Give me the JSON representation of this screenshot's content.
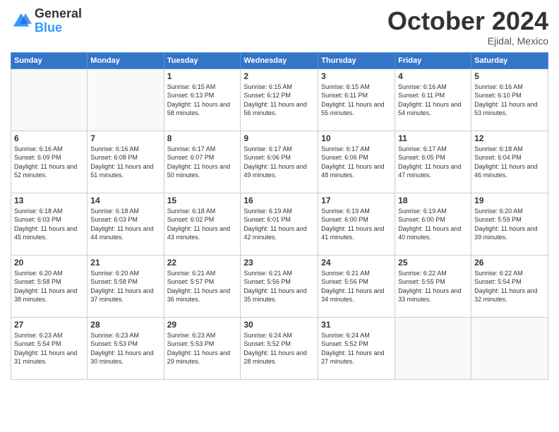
{
  "header": {
    "logo": {
      "general": "General",
      "blue": "Blue"
    },
    "title": "October 2024",
    "subtitle": "Ejidal, Mexico"
  },
  "weekdays": [
    "Sunday",
    "Monday",
    "Tuesday",
    "Wednesday",
    "Thursday",
    "Friday",
    "Saturday"
  ],
  "weeks": [
    [
      {
        "day": "",
        "empty": true
      },
      {
        "day": "",
        "empty": true
      },
      {
        "day": "1",
        "sunrise": "Sunrise: 6:15 AM",
        "sunset": "Sunset: 6:13 PM",
        "daylight": "Daylight: 11 hours and 58 minutes."
      },
      {
        "day": "2",
        "sunrise": "Sunrise: 6:15 AM",
        "sunset": "Sunset: 6:12 PM",
        "daylight": "Daylight: 11 hours and 56 minutes."
      },
      {
        "day": "3",
        "sunrise": "Sunrise: 6:15 AM",
        "sunset": "Sunset: 6:11 PM",
        "daylight": "Daylight: 11 hours and 55 minutes."
      },
      {
        "day": "4",
        "sunrise": "Sunrise: 6:16 AM",
        "sunset": "Sunset: 6:11 PM",
        "daylight": "Daylight: 11 hours and 54 minutes."
      },
      {
        "day": "5",
        "sunrise": "Sunrise: 6:16 AM",
        "sunset": "Sunset: 6:10 PM",
        "daylight": "Daylight: 11 hours and 53 minutes."
      }
    ],
    [
      {
        "day": "6",
        "sunrise": "Sunrise: 6:16 AM",
        "sunset": "Sunset: 6:09 PM",
        "daylight": "Daylight: 11 hours and 52 minutes."
      },
      {
        "day": "7",
        "sunrise": "Sunrise: 6:16 AM",
        "sunset": "Sunset: 6:08 PM",
        "daylight": "Daylight: 11 hours and 51 minutes."
      },
      {
        "day": "8",
        "sunrise": "Sunrise: 6:17 AM",
        "sunset": "Sunset: 6:07 PM",
        "daylight": "Daylight: 11 hours and 50 minutes."
      },
      {
        "day": "9",
        "sunrise": "Sunrise: 6:17 AM",
        "sunset": "Sunset: 6:06 PM",
        "daylight": "Daylight: 11 hours and 49 minutes."
      },
      {
        "day": "10",
        "sunrise": "Sunrise: 6:17 AM",
        "sunset": "Sunset: 6:06 PM",
        "daylight": "Daylight: 11 hours and 48 minutes."
      },
      {
        "day": "11",
        "sunrise": "Sunrise: 6:17 AM",
        "sunset": "Sunset: 6:05 PM",
        "daylight": "Daylight: 11 hours and 47 minutes."
      },
      {
        "day": "12",
        "sunrise": "Sunrise: 6:18 AM",
        "sunset": "Sunset: 6:04 PM",
        "daylight": "Daylight: 11 hours and 46 minutes."
      }
    ],
    [
      {
        "day": "13",
        "sunrise": "Sunrise: 6:18 AM",
        "sunset": "Sunset: 6:03 PM",
        "daylight": "Daylight: 11 hours and 45 minutes."
      },
      {
        "day": "14",
        "sunrise": "Sunrise: 6:18 AM",
        "sunset": "Sunset: 6:03 PM",
        "daylight": "Daylight: 11 hours and 44 minutes."
      },
      {
        "day": "15",
        "sunrise": "Sunrise: 6:18 AM",
        "sunset": "Sunset: 6:02 PM",
        "daylight": "Daylight: 11 hours and 43 minutes."
      },
      {
        "day": "16",
        "sunrise": "Sunrise: 6:19 AM",
        "sunset": "Sunset: 6:01 PM",
        "daylight": "Daylight: 11 hours and 42 minutes."
      },
      {
        "day": "17",
        "sunrise": "Sunrise: 6:19 AM",
        "sunset": "Sunset: 6:00 PM",
        "daylight": "Daylight: 11 hours and 41 minutes."
      },
      {
        "day": "18",
        "sunrise": "Sunrise: 6:19 AM",
        "sunset": "Sunset: 6:00 PM",
        "daylight": "Daylight: 11 hours and 40 minutes."
      },
      {
        "day": "19",
        "sunrise": "Sunrise: 6:20 AM",
        "sunset": "Sunset: 5:59 PM",
        "daylight": "Daylight: 11 hours and 39 minutes."
      }
    ],
    [
      {
        "day": "20",
        "sunrise": "Sunrise: 6:20 AM",
        "sunset": "Sunset: 5:58 PM",
        "daylight": "Daylight: 11 hours and 38 minutes."
      },
      {
        "day": "21",
        "sunrise": "Sunrise: 6:20 AM",
        "sunset": "Sunset: 5:58 PM",
        "daylight": "Daylight: 11 hours and 37 minutes."
      },
      {
        "day": "22",
        "sunrise": "Sunrise: 6:21 AM",
        "sunset": "Sunset: 5:57 PM",
        "daylight": "Daylight: 11 hours and 36 minutes."
      },
      {
        "day": "23",
        "sunrise": "Sunrise: 6:21 AM",
        "sunset": "Sunset: 5:56 PM",
        "daylight": "Daylight: 11 hours and 35 minutes."
      },
      {
        "day": "24",
        "sunrise": "Sunrise: 6:21 AM",
        "sunset": "Sunset: 5:56 PM",
        "daylight": "Daylight: 11 hours and 34 minutes."
      },
      {
        "day": "25",
        "sunrise": "Sunrise: 6:22 AM",
        "sunset": "Sunset: 5:55 PM",
        "daylight": "Daylight: 11 hours and 33 minutes."
      },
      {
        "day": "26",
        "sunrise": "Sunrise: 6:22 AM",
        "sunset": "Sunset: 5:54 PM",
        "daylight": "Daylight: 11 hours and 32 minutes."
      }
    ],
    [
      {
        "day": "27",
        "sunrise": "Sunrise: 6:23 AM",
        "sunset": "Sunset: 5:54 PM",
        "daylight": "Daylight: 11 hours and 31 minutes."
      },
      {
        "day": "28",
        "sunrise": "Sunrise: 6:23 AM",
        "sunset": "Sunset: 5:53 PM",
        "daylight": "Daylight: 11 hours and 30 minutes."
      },
      {
        "day": "29",
        "sunrise": "Sunrise: 6:23 AM",
        "sunset": "Sunset: 5:53 PM",
        "daylight": "Daylight: 11 hours and 29 minutes."
      },
      {
        "day": "30",
        "sunrise": "Sunrise: 6:24 AM",
        "sunset": "Sunset: 5:52 PM",
        "daylight": "Daylight: 11 hours and 28 minutes."
      },
      {
        "day": "31",
        "sunrise": "Sunrise: 6:24 AM",
        "sunset": "Sunset: 5:52 PM",
        "daylight": "Daylight: 11 hours and 27 minutes."
      },
      {
        "day": "",
        "empty": true
      },
      {
        "day": "",
        "empty": true
      }
    ]
  ]
}
